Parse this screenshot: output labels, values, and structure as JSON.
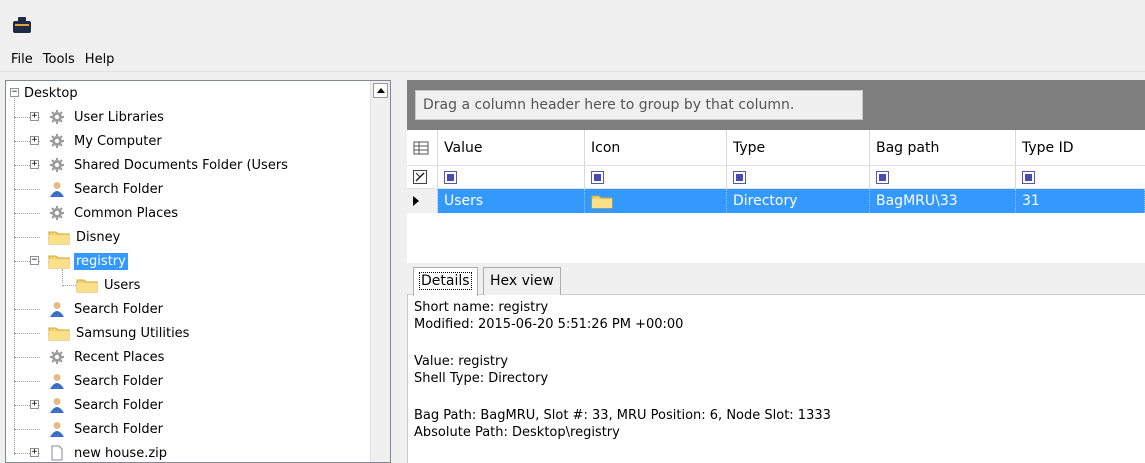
{
  "menu": {
    "items": [
      "File",
      "Tools",
      "Help"
    ]
  },
  "tree": {
    "root": "Desktop",
    "items": [
      {
        "label": "User Libraries",
        "icon": "gear-folder-icon",
        "expander": "+"
      },
      {
        "label": "My Computer",
        "icon": "gear-folder-icon",
        "expander": "+"
      },
      {
        "label": "Shared Documents Folder (Users",
        "icon": "gear-folder-icon",
        "expander": "+"
      },
      {
        "label": "Search Folder",
        "icon": "user-icon",
        "expander": ""
      },
      {
        "label": "Common Places",
        "icon": "gear-folder-icon",
        "expander": ""
      },
      {
        "label": "Disney",
        "icon": "folder-icon",
        "expander": ""
      },
      {
        "label": "registry",
        "icon": "folder-icon",
        "expander": "-"
      },
      {
        "label": "Users",
        "icon": "folder-icon",
        "expander": ""
      },
      {
        "label": "Search Folder",
        "icon": "user-icon",
        "expander": ""
      },
      {
        "label": "Samsung Utilities",
        "icon": "folder-icon",
        "expander": ""
      },
      {
        "label": "Recent Places",
        "icon": "gear-folder-icon",
        "expander": ""
      },
      {
        "label": "Search Folder",
        "icon": "user-icon",
        "expander": ""
      },
      {
        "label": "Search Folder",
        "icon": "user-icon",
        "expander": "+"
      },
      {
        "label": "Search Folder",
        "icon": "user-icon",
        "expander": ""
      },
      {
        "label": "new house.zip",
        "icon": "file-icon",
        "expander": "+"
      }
    ]
  },
  "grid": {
    "group_hint": "Drag a column header here to group by that column.",
    "columns": [
      "Value",
      "Icon",
      "Type",
      "Bag path",
      "Type ID"
    ],
    "rows": [
      {
        "value": "Users",
        "type": "Directory",
        "bag_path": "BagMRU\\33",
        "type_id": "31"
      }
    ]
  },
  "tabs": [
    "Details",
    "Hex view"
  ],
  "details": {
    "short_name": "Short name: registry",
    "modified": "Modified: 2015-06-20 5:51:26 PM +00:00",
    "value": "Value: registry",
    "shell_type": "Shell Type: Directory",
    "bag_path": "Bag Path: BagMRU, Slot #: 33, MRU Position: 6, Node Slot: 1333",
    "absolute_path": "Absolute Path: Desktop\\registry"
  },
  "colors": {
    "selection": "#3399ff",
    "group_panel": "#7e7e7e",
    "folder": "#f5d26b"
  }
}
